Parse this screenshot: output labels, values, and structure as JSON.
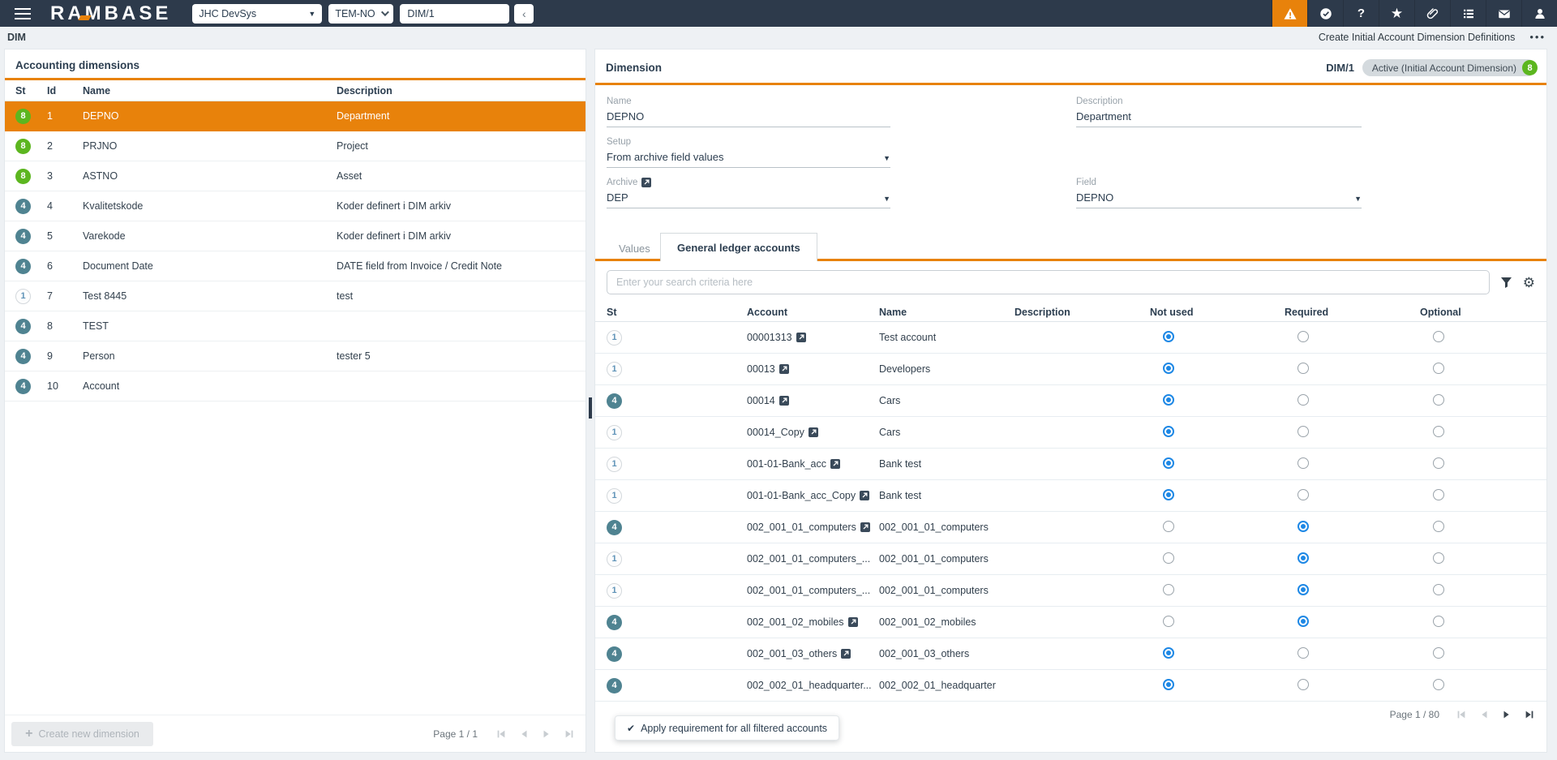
{
  "topbar": {
    "brand": "RAMBASE",
    "system_select": "JHC DevSys",
    "locale_select": "TEM-NO",
    "program_value": "DIM/1",
    "icons": [
      "warning",
      "verified",
      "help",
      "favorites",
      "attachment",
      "task-list",
      "mail",
      "user"
    ]
  },
  "subheader": {
    "app_code": "DIM",
    "action_label": "Create Initial Account Dimension Definitions"
  },
  "left_panel": {
    "title": "Accounting dimensions",
    "columns": [
      "St",
      "Id",
      "Name",
      "Description"
    ],
    "rows": [
      {
        "st": "8",
        "st_type": "green",
        "id": "1",
        "name": "DEPNO",
        "description": "Department",
        "selected": true
      },
      {
        "st": "8",
        "st_type": "green",
        "id": "2",
        "name": "PRJNO",
        "description": "Project"
      },
      {
        "st": "8",
        "st_type": "green",
        "id": "3",
        "name": "ASTNO",
        "description": "Asset"
      },
      {
        "st": "4",
        "st_type": "teal",
        "id": "4",
        "name": "Kvalitetskode",
        "description": "Koder definert i DIM arkiv"
      },
      {
        "st": "4",
        "st_type": "teal",
        "id": "5",
        "name": "Varekode",
        "description": "Koder definert i DIM arkiv"
      },
      {
        "st": "4",
        "st_type": "teal",
        "id": "6",
        "name": "Document Date",
        "description": "DATE field from Invoice / Credit Note"
      },
      {
        "st": "1",
        "st_type": "gray",
        "id": "7",
        "name": "Test 8445",
        "description": "test"
      },
      {
        "st": "4",
        "st_type": "teal",
        "id": "8",
        "name": "TEST",
        "description": ""
      },
      {
        "st": "4",
        "st_type": "teal",
        "id": "9",
        "name": "Person",
        "description": "tester 5"
      },
      {
        "st": "4",
        "st_type": "teal",
        "id": "10",
        "name": "Account",
        "description": ""
      }
    ],
    "footer": {
      "create_button": "Create new dimension",
      "page_label": "Page 1 / 1"
    }
  },
  "right_panel": {
    "title": "Dimension",
    "doc_id": "DIM/1",
    "status_badge": "Active (Initial Account Dimension)",
    "status_count": "8",
    "fields": {
      "name": {
        "label": "Name",
        "value": "DEPNO"
      },
      "description": {
        "label": "Description",
        "value": "Department"
      },
      "setup": {
        "label": "Setup",
        "value": "From archive field values"
      },
      "archive": {
        "label": "Archive",
        "value": "DEP"
      },
      "field": {
        "label": "Field",
        "value": "DEPNO"
      }
    },
    "tabs": [
      {
        "label": "Values",
        "active": false
      },
      {
        "label": "General ledger accounts",
        "active": true
      }
    ],
    "search_placeholder": "Enter your search criteria here",
    "table": {
      "columns": [
        "St",
        "Account",
        "Name",
        "Description",
        "Not used",
        "Required",
        "Optional"
      ],
      "rows": [
        {
          "st": "1",
          "st_type": "gray",
          "account": "00001313",
          "link": true,
          "name": "Test account",
          "description": "",
          "selection": "not_used"
        },
        {
          "st": "1",
          "st_type": "gray",
          "account": "00013",
          "link": true,
          "name": "Developers",
          "description": "",
          "selection": "not_used"
        },
        {
          "st": "4",
          "st_type": "teal",
          "account": "00014",
          "link": true,
          "name": "Cars",
          "description": "",
          "selection": "not_used"
        },
        {
          "st": "1",
          "st_type": "gray",
          "account": "00014_Copy",
          "link": true,
          "name": "Cars",
          "description": "",
          "selection": "not_used"
        },
        {
          "st": "1",
          "st_type": "gray",
          "account": "001-01-Bank_acc",
          "link": true,
          "name": "Bank test",
          "description": "",
          "selection": "not_used"
        },
        {
          "st": "1",
          "st_type": "gray",
          "account": "001-01-Bank_acc_Copy",
          "link": true,
          "name": "Bank test",
          "description": "",
          "selection": "not_used"
        },
        {
          "st": "4",
          "st_type": "teal",
          "account": "002_001_01_computers",
          "link": true,
          "name": "002_001_01_computers",
          "description": "",
          "selection": "required"
        },
        {
          "st": "1",
          "st_type": "gray",
          "account": "002_001_01_computers_...",
          "link": false,
          "name": "002_001_01_computers",
          "description": "",
          "selection": "required"
        },
        {
          "st": "1",
          "st_type": "gray",
          "account": "002_001_01_computers_...",
          "link": false,
          "name": "002_001_01_computers",
          "description": "",
          "selection": "required"
        },
        {
          "st": "4",
          "st_type": "teal",
          "account": "002_001_02_mobiles",
          "link": true,
          "name": "002_001_02_mobiles",
          "description": "",
          "selection": "required"
        },
        {
          "st": "4",
          "st_type": "teal",
          "account": "002_001_03_others",
          "link": true,
          "name": "002_001_03_others",
          "description": "",
          "selection": "not_used"
        },
        {
          "st": "4",
          "st_type": "teal",
          "account": "002_002_01_headquarter...",
          "link": false,
          "name": "002_002_01_headquarter",
          "description": "",
          "selection": "not_used"
        }
      ]
    },
    "pagination": {
      "label": "Page 1 / 80"
    },
    "apply_button": "Apply requirement for all filtered accounts"
  }
}
